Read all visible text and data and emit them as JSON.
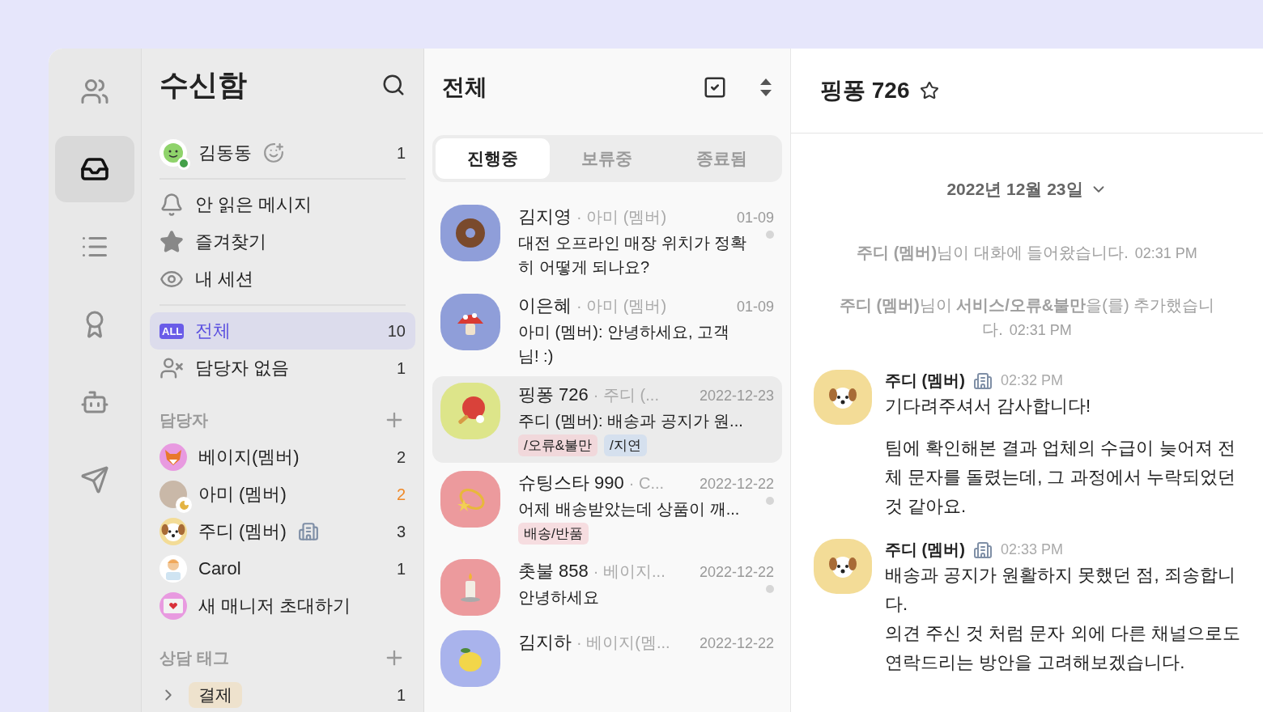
{
  "rail": [
    {
      "kind": "people",
      "selected": false
    },
    {
      "kind": "inbox",
      "selected": true
    },
    {
      "kind": "list",
      "selected": false
    },
    {
      "kind": "award",
      "selected": false
    },
    {
      "kind": "bot",
      "selected": false
    },
    {
      "kind": "send",
      "selected": false
    }
  ],
  "sidebar": {
    "title": "수신함",
    "user": {
      "name": "김동동",
      "count": "1",
      "online": true
    },
    "nav": [
      {
        "kind": "bell",
        "label": "안 읽은 메시지"
      },
      {
        "kind": "star",
        "label": "즐겨찾기"
      },
      {
        "kind": "eye",
        "label": "내 세션"
      }
    ],
    "filters": [
      {
        "kind": "all",
        "badge": "ALL",
        "label": "전체",
        "count": "10",
        "selected": true
      },
      {
        "kind": "unassigned",
        "label": "담당자 없음",
        "count": "1",
        "selected": false
      }
    ],
    "assignees": {
      "title": "담당자",
      "items": [
        {
          "avatar": {
            "kind": "fox"
          },
          "name": "베이지(멤버)",
          "count": "2"
        },
        {
          "avatar": {
            "kind": "photo"
          },
          "name": "아미 (멤버)",
          "count": "2",
          "alert": true,
          "away": true
        },
        {
          "avatar": {
            "kind": "dog"
          },
          "name": "주디 (멤버)",
          "count": "3",
          "office": true
        },
        {
          "avatar": {
            "kind": "agent"
          },
          "name": "Carol",
          "count": "1"
        },
        {
          "avatar": {
            "kind": "letter"
          },
          "name": "새 매니저 초대하기"
        }
      ]
    },
    "tags": {
      "title": "상담 태그",
      "items": [
        {
          "label": "결제",
          "count": "1",
          "expanded": false,
          "color": "#eee2cd"
        }
      ]
    }
  },
  "list": {
    "title": "전체",
    "tabs": [
      {
        "label": "진행중",
        "selected": true
      },
      {
        "label": "보류중",
        "selected": false
      },
      {
        "label": "종료됨",
        "selected": false
      }
    ],
    "conversations": [
      {
        "avatar": {
          "kind": "donut"
        },
        "name": "김지영",
        "assignee": "· 아미 (멤버)",
        "date": "01-09",
        "preview": "대전 오프라인 매장 위치가 정확히 어떻게 되나요?",
        "unread": true,
        "selected": false
      },
      {
        "avatar": {
          "kind": "mushroom"
        },
        "name": "이은혜",
        "assignee": "· 아미 (멤버)",
        "date": "01-09",
        "preview": "아미 (멤버): 안녕하세요, 고객님! :)",
        "selected": false
      },
      {
        "avatar": {
          "kind": "paddle"
        },
        "name": "핑퐁 726",
        "assignee": "· 주디 (...",
        "date": "2022-12-23",
        "preview": "주디 (멤버): 배송과 공지가 원...",
        "selected": true,
        "tags": [
          {
            "label": "/오류&불만",
            "color": "#f1d8db"
          },
          {
            "label": "/지연",
            "color": "#d5e0ee"
          }
        ]
      },
      {
        "avatar": {
          "kind": "star"
        },
        "name": "슈팅스타 990",
        "assignee": "· C...",
        "date": "2022-12-22",
        "preview": "어제 배송받았는데 상품이 깨...",
        "unread": true,
        "selected": false,
        "tags": [
          {
            "label": "배송/반품",
            "color": "#f6dde0"
          }
        ]
      },
      {
        "avatar": {
          "kind": "candle"
        },
        "name": "촛불 858",
        "assignee": "· 베이지...",
        "date": "2022-12-22",
        "preview": "안녕하세요",
        "unread": true,
        "selected": false
      },
      {
        "avatar": {
          "kind": "lemon"
        },
        "name": "김지하",
        "assignee": "· 베이지(멤...",
        "date": "2022-12-22",
        "selected": false
      }
    ]
  },
  "chat": {
    "title": "핑퐁 726",
    "starred": false,
    "date": "2022년 12월 23일",
    "events": [
      {
        "kind": "system",
        "text": "**주디 (멤버)**님이 대화에 들어왔습니다.",
        "time": "02:31 PM"
      },
      {
        "kind": "system",
        "text": "**주디 (멤버)**님이 **서비스/오류&불만**을(를) 추가했습니다.",
        "time": "02:31 PM"
      },
      {
        "kind": "message",
        "avatar": {
          "kind": "dog"
        },
        "author": "주디 (멤버)",
        "time": "02:32 PM",
        "blocks": [
          [
            "기다려주셔서 감사합니다!"
          ],
          [
            "팀에 확인해본 결과 업체의 수급이 늦어져 전체 문자를 돌렸는데, 그 과정에서 누락되었던 것 같아요."
          ]
        ]
      },
      {
        "kind": "message",
        "avatar": {
          "kind": "dog"
        },
        "author": "주디 (멤버)",
        "time": "02:33 PM",
        "blocks": [
          [
            "배송과 공지가 원활하지 못했던 점, 죄송합니다.",
            "의견 주신 것 처럼 문자 외에 다른 채널으로도 연락드리는 방안을 고려해보겠습니다."
          ]
        ]
      }
    ]
  }
}
